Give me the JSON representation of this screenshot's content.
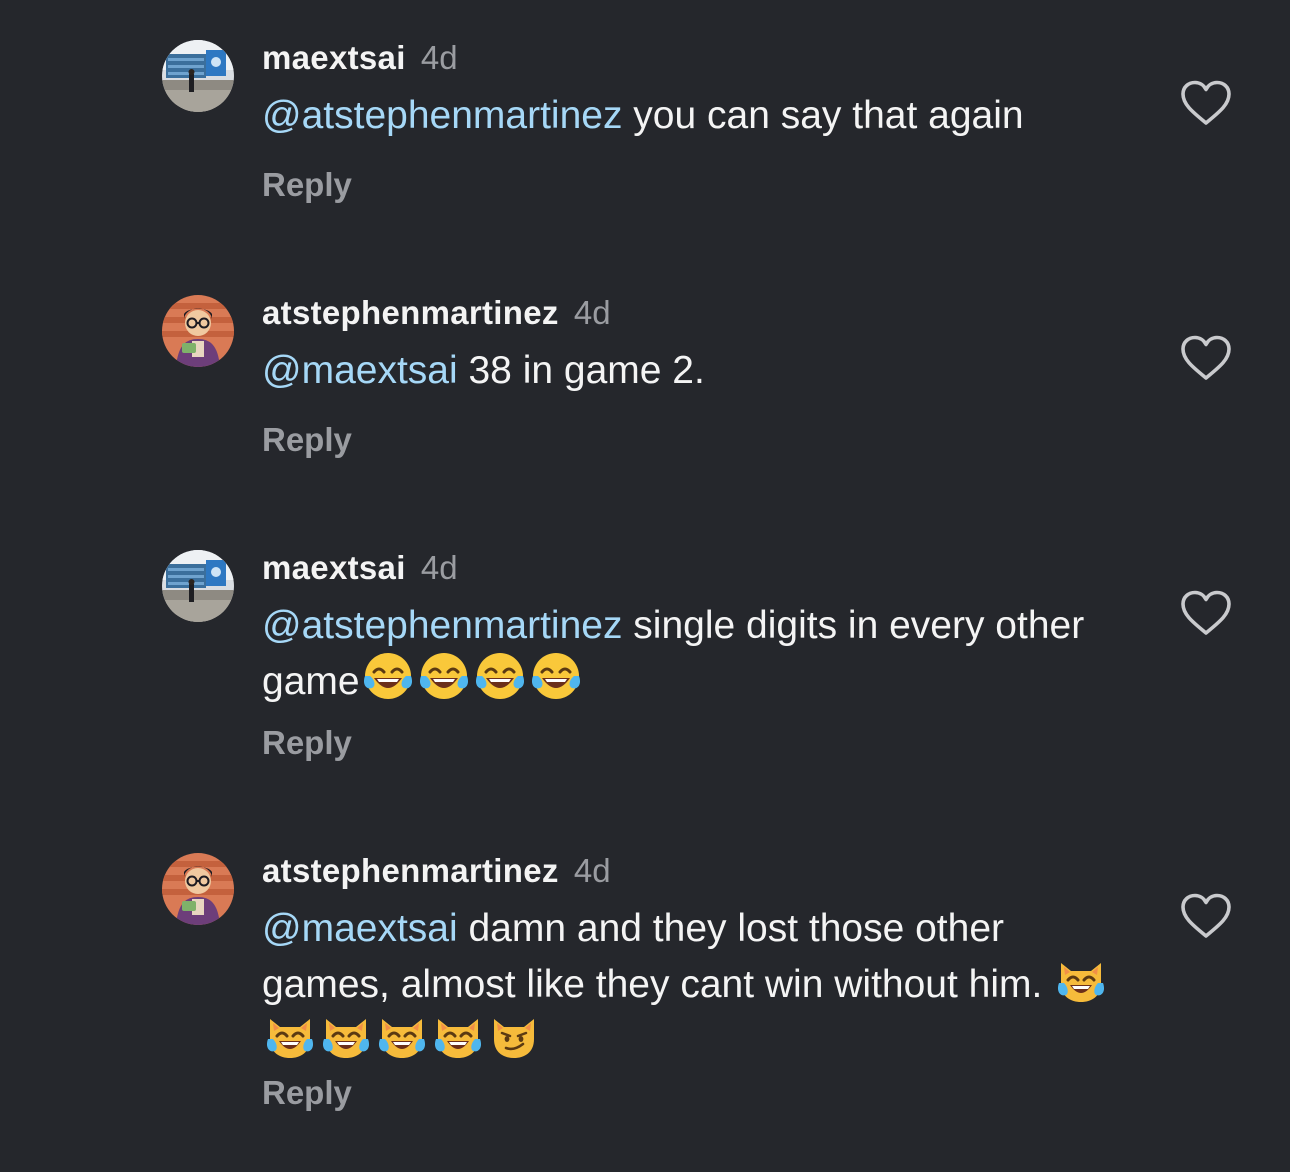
{
  "comments": [
    {
      "username": "maextsai",
      "time": "4d",
      "mention": "@atstephenmartinez",
      "text": " you can say that again",
      "reply_label": "Reply",
      "avatar": "maextsai-avatar",
      "emojis": []
    },
    {
      "username": "atstephenmartinez",
      "time": "4d",
      "mention": "@maextsai",
      "text": " 38 in game 2.",
      "reply_label": "Reply",
      "avatar": "atstephenmartinez-avatar",
      "emojis": []
    },
    {
      "username": "maextsai",
      "time": "4d",
      "mention": "@atstephenmartinez",
      "text": " single digits in every other game",
      "reply_label": "Reply",
      "avatar": "maextsai-avatar",
      "emojis": [
        "face-with-tears-of-joy",
        "face-with-tears-of-joy",
        "face-with-tears-of-joy",
        "face-with-tears-of-joy"
      ]
    },
    {
      "username": "atstephenmartinez",
      "time": "4d",
      "mention": "@maextsai",
      "text": " damn and they lost those other games, almost like they cant win without him. ",
      "reply_label": "Reply",
      "avatar": "atstephenmartinez-avatar",
      "emojis": [
        "cat-with-tears-of-joy",
        "cat-with-tears-of-joy",
        "cat-with-tears-of-joy",
        "cat-with-tears-of-joy",
        "cat-with-tears-of-joy",
        "cat-with-wry-smile"
      ]
    }
  ],
  "icons": {
    "like": "heart-outline-icon"
  },
  "colors": {
    "background": "#25272c",
    "mention": "#a6d8f7",
    "secondary_text": "#9a9ca1",
    "primary_text": "#f4f4f4"
  }
}
